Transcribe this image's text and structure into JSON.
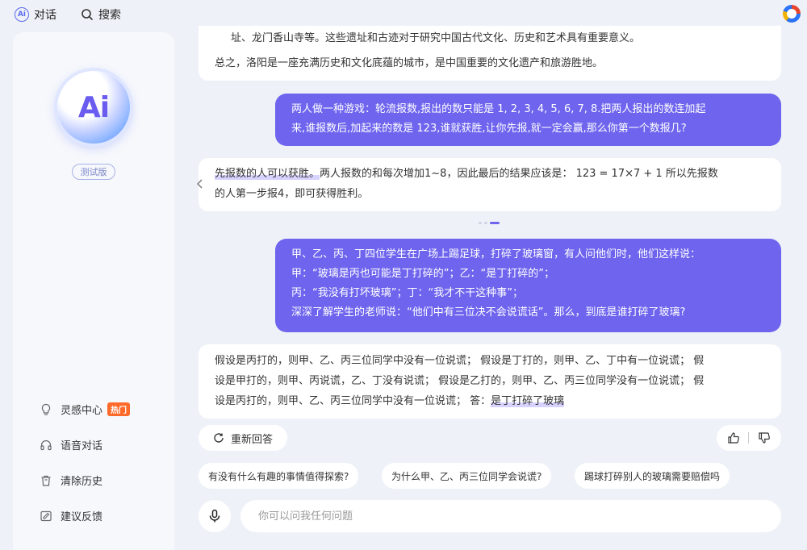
{
  "topbar": {
    "tabs": [
      {
        "label": "对话",
        "icon": "ai-chat-icon"
      },
      {
        "label": "搜索",
        "icon": "search-icon"
      }
    ],
    "brand_icon": "browser-logo-icon"
  },
  "sidebar": {
    "avatar_text": "Ai",
    "badge": "测试版",
    "menu": [
      {
        "label": "灵感中心",
        "icon": "lightbulb-icon",
        "tag": "热门"
      },
      {
        "label": "语音对话",
        "icon": "headset-icon"
      },
      {
        "label": "清除历史",
        "icon": "trash-icon"
      },
      {
        "label": "建议反馈",
        "icon": "feedback-icon"
      }
    ]
  },
  "chat": {
    "messages": [
      {
        "role": "bot",
        "lines": [
          "址、龙门香山寺等。这些遗址和古迹对于研究中国古代文化、历史和艺术具有重要意义。",
          "总之，洛阳是一座充满历史和文化底蕴的城市，是中国重要的文化遗产和旅游胜地。"
        ]
      },
      {
        "role": "user",
        "lines": [
          "两人做一种游戏：轮流报数,报出的数只能是 1, 2, 3, 4, 5, 6, 7, 8.把两人报出的数连加起",
          "来,谁报数后,加起来的数是 123,谁就获胜,让你先报,就一定会赢,那么你第一个数报几?"
        ]
      },
      {
        "role": "bot",
        "highlight": "先报数的人可以获胜。",
        "lines": [
          "两人报数的和每次增加1~8，因此最后的结果应该是： 123 = 17×7 + 1 所以先报数",
          "的人第一步报4，即可获得胜利。"
        ]
      },
      {
        "role": "user",
        "lines": [
          "甲、乙、丙、丁四位学生在广场上踢足球，打碎了玻璃窗，有人问他们时，他们这样说：",
          "甲：“玻璃是丙也可能是丁打碎的”；乙：“是丁打碎的”；",
          "丙：“我没有打坏玻璃”；丁：“我才不干这种事”；",
          "深深了解学生的老师说：“他们中有三位决不会说谎话”。那么，到底是谁打碎了玻璃?"
        ]
      },
      {
        "role": "bot",
        "lines": [
          "假设是丙打的，则甲、乙、丙三位同学中没有一位说谎；  假设是丁打的，则甲、乙、丁中有一位说谎；  假",
          "设是甲打的，则甲、丙说谎，乙、丁没有说谎；  假设是乙打的，则甲、乙、丙三位同学没有一位说谎；  假",
          "设是丙打的，则甲、乙、丙三位同学中没有一位说谎；  答："
        ],
        "highlight_end": "是丁打碎了玻璃"
      }
    ],
    "regenerate_label": "重新回答",
    "suggestions": [
      "有没有什么有趣的事情值得探索?",
      "为什么甲、乙、丙三位同学会说谎?",
      "踢球打碎别人的玻璃需要赔偿吗"
    ],
    "input_placeholder": "你可以问我任何问题"
  }
}
